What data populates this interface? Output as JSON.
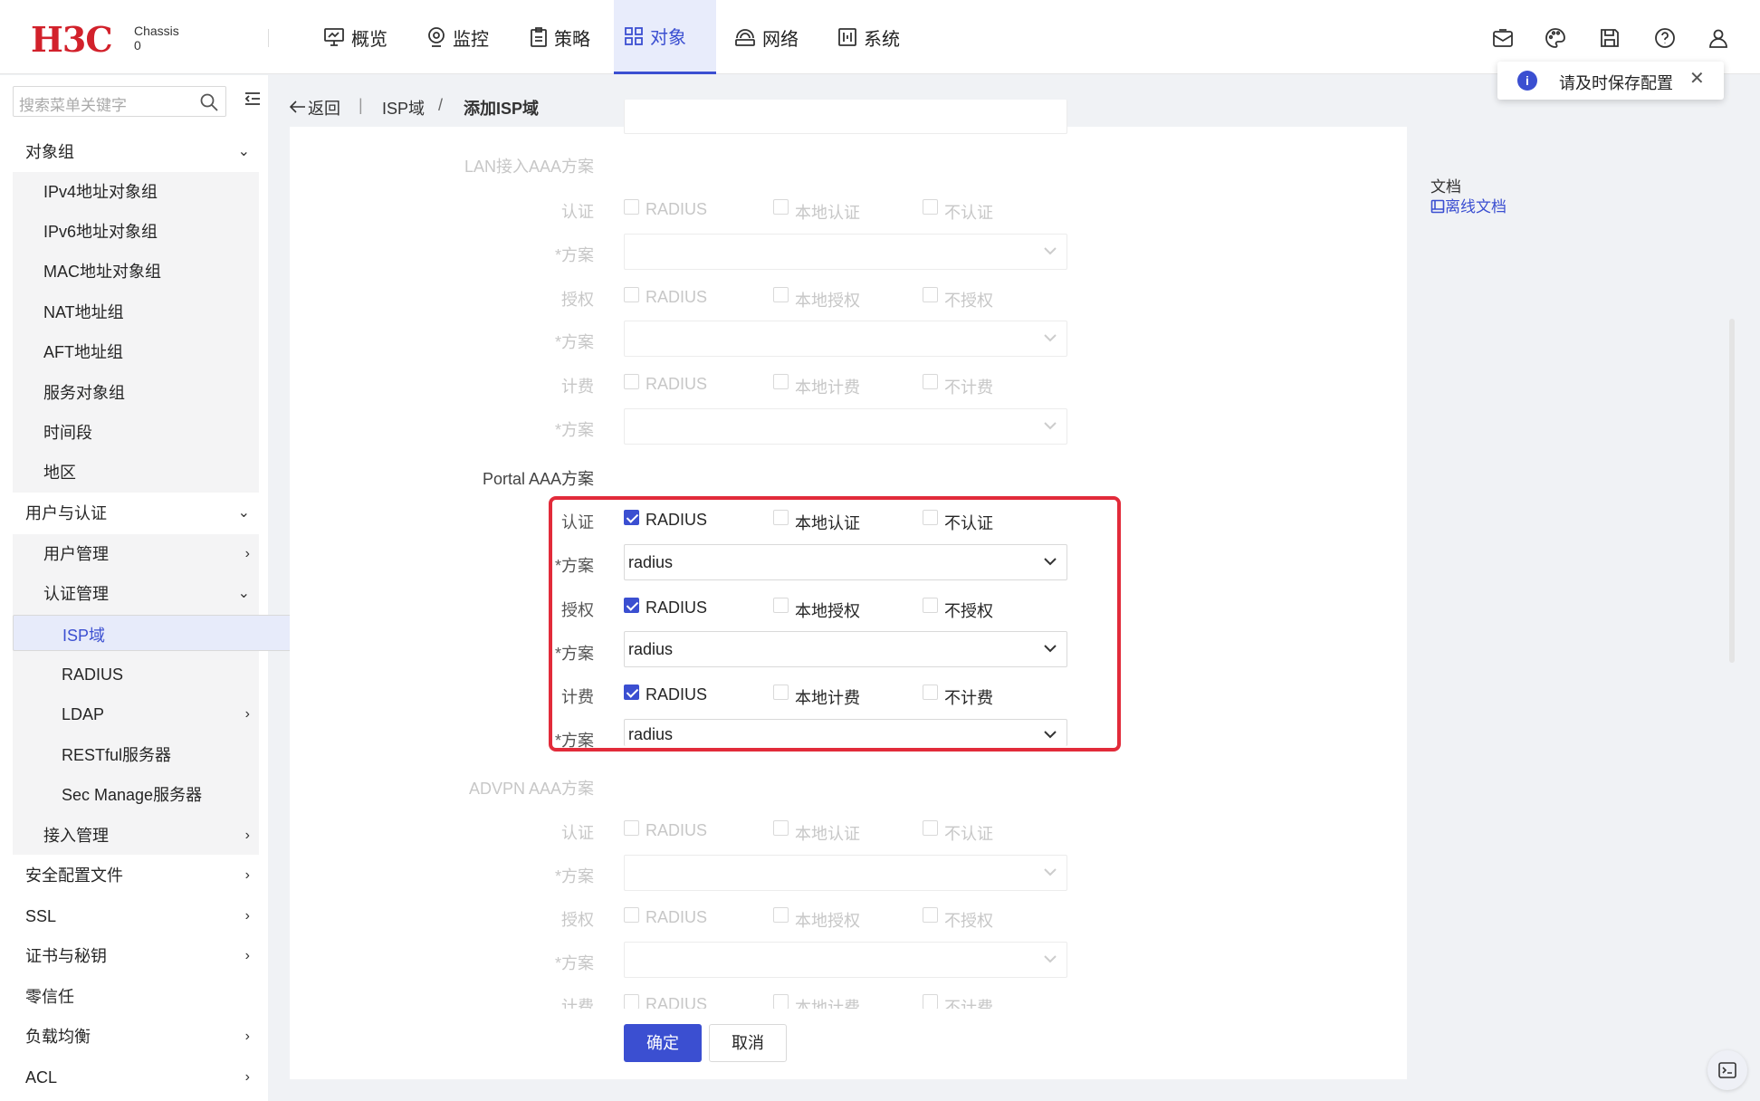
{
  "header": {
    "logo": "H3C",
    "chassis_label": "Chassis",
    "chassis_num": "0",
    "nav": [
      {
        "label": "概览",
        "icon": "monitor-icon"
      },
      {
        "label": "监控",
        "icon": "camera-icon"
      },
      {
        "label": "策略",
        "icon": "clipboard-icon"
      },
      {
        "label": "对象",
        "icon": "grid-icon"
      },
      {
        "label": "网络",
        "icon": "network-icon"
      },
      {
        "label": "系统",
        "icon": "system-icon"
      }
    ],
    "active_nav": "对象",
    "toast_text": "请及时保存配置",
    "toast_icon": "i",
    "toast_close": "✕"
  },
  "sidebar": {
    "search_placeholder": "搜索菜单关键字",
    "items": [
      {
        "label": "对象组",
        "chev": "⌄"
      },
      {
        "label": "IPv4地址对象组"
      },
      {
        "label": "IPv6地址对象组"
      },
      {
        "label": "MAC地址对象组"
      },
      {
        "label": "NAT地址组"
      },
      {
        "label": "AFT地址组"
      },
      {
        "label": "服务对象组"
      },
      {
        "label": "时间段"
      },
      {
        "label": "地区"
      },
      {
        "label": "用户与认证",
        "chev": "⌄"
      },
      {
        "label": "用户管理",
        "chev": "›"
      },
      {
        "label": "认证管理",
        "chev": "⌄"
      },
      {
        "label": "ISP域"
      },
      {
        "label": "RADIUS"
      },
      {
        "label": "LDAP",
        "chev": "›"
      },
      {
        "label": "RESTful服务器"
      },
      {
        "label": "Sec Manage服务器"
      },
      {
        "label": "接入管理",
        "chev": "›"
      },
      {
        "label": "安全配置文件",
        "chev": "›"
      },
      {
        "label": "SSL",
        "chev": "›"
      },
      {
        "label": "证书与秘钥",
        "chev": "›"
      },
      {
        "label": "零信任"
      },
      {
        "label": "负载均衡",
        "chev": "›"
      },
      {
        "label": "ACL",
        "chev": "›"
      }
    ]
  },
  "breadcrumb": {
    "back": "返回",
    "sep1": "|",
    "crumb1": "ISP域",
    "sep2": "/",
    "crumb2": "添加ISP域"
  },
  "form": {
    "lan_title": "LAN接入AAA方案",
    "portal_title": "Portal AAA方案",
    "advpn_title": "ADVPN AAA方案",
    "labels": {
      "auth": "认证",
      "authz": "授权",
      "acct": "计费",
      "scheme": "*方案"
    },
    "opts": {
      "radius": "RADIUS",
      "local_auth": "本地认证",
      "no_auth": "不认证",
      "local_authz": "本地授权",
      "no_authz": "不授权",
      "local_acct": "本地计费",
      "no_acct": "不计费"
    },
    "portal_scheme_values": [
      "radius",
      "radius",
      "radius"
    ]
  },
  "buttons": {
    "ok": "确定",
    "cancel": "取消"
  },
  "doc": {
    "title": "文档",
    "link": "离线文档"
  }
}
